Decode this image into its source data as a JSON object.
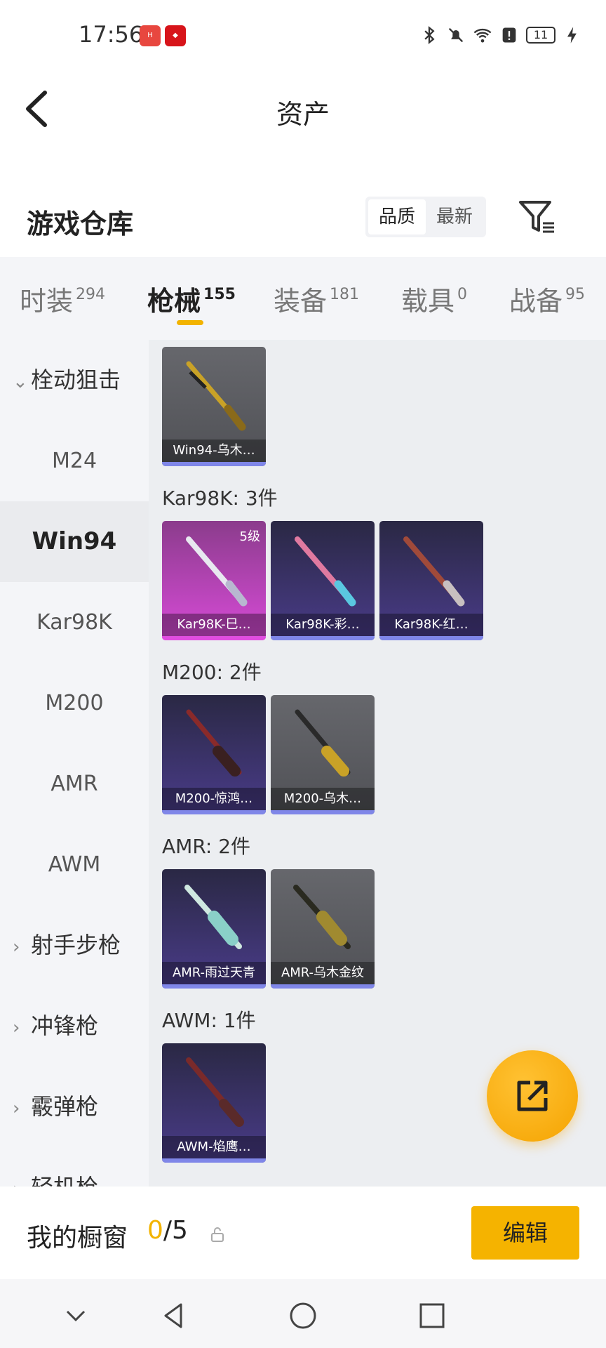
{
  "status_bar": {
    "time": "17:56",
    "battery": "11"
  },
  "header": {
    "title": "资产"
  },
  "warehouse": {
    "title": "游戏仓库",
    "sort_options": [
      "品质",
      "最新"
    ],
    "active_sort": "品质"
  },
  "tabs": [
    {
      "label": "时装",
      "count": "294"
    },
    {
      "label": "枪械",
      "count": "155"
    },
    {
      "label": "装备",
      "count": "181"
    },
    {
      "label": "载具",
      "count": "0"
    },
    {
      "label": "战备",
      "count": "95"
    }
  ],
  "sidebar": {
    "group_open": "栓动狙击",
    "items": [
      "M24",
      "Win94",
      "Kar98K",
      "M200",
      "AMR",
      "AWM"
    ],
    "selected": "Win94",
    "groups": [
      "射手步枪",
      "冲锋枪",
      "霰弹枪",
      "轻机枪"
    ]
  },
  "sections": [
    {
      "label": "",
      "cards": [
        {
          "name": "Win94-乌木…",
          "style": "grey"
        }
      ]
    },
    {
      "label": "Kar98K: 3件",
      "cards": [
        {
          "name": "Kar98K-巳…",
          "style": "pink",
          "level": "5级"
        },
        {
          "name": "Kar98K-彩…",
          "style": "purple"
        },
        {
          "name": "Kar98K-红…",
          "style": "purple"
        }
      ]
    },
    {
      "label": "M200: 2件",
      "cards": [
        {
          "name": "M200-惊鸿…",
          "style": "purple"
        },
        {
          "name": "M200-乌木…",
          "style": "grey"
        }
      ]
    },
    {
      "label": "AMR: 2件",
      "cards": [
        {
          "name": "AMR-雨过天青",
          "style": "purple"
        },
        {
          "name": "AMR-乌木金纹",
          "style": "grey"
        }
      ]
    },
    {
      "label": "AWM: 1件",
      "cards": [
        {
          "name": "AWM-焰鹰…",
          "style": "purple"
        }
      ]
    }
  ],
  "showcase": {
    "label": "我的橱窗",
    "count_current": "0",
    "count_total": "/5",
    "edit_label": "编辑"
  },
  "colors": {
    "accent": "#f5b300",
    "card_bar": "#7f86e8"
  }
}
